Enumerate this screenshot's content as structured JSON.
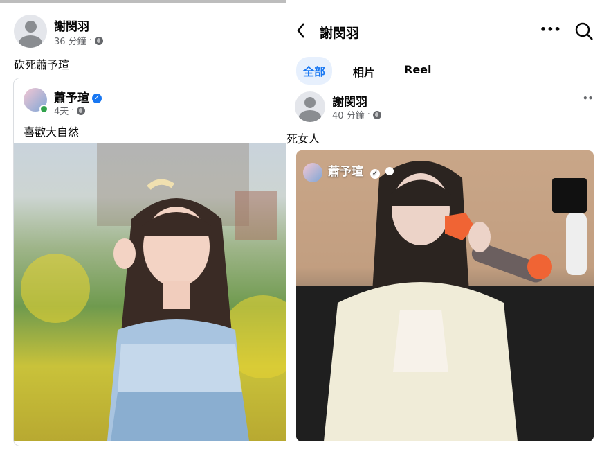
{
  "left": {
    "author": {
      "name": "謝閔羽",
      "time": "36 分鐘",
      "dot": "·"
    },
    "post_text": "砍死蕭予瑄",
    "shared_post": {
      "author": "蕭予瑄",
      "time": "4天",
      "dot": "·",
      "text": "喜歡大自然"
    }
  },
  "right": {
    "header": {
      "back": "<",
      "title": "謝閔羽",
      "more": "•••"
    },
    "tabs": [
      {
        "label": "全部",
        "active": true
      },
      {
        "label": "相片",
        "active": false
      },
      {
        "label": "Reel",
        "active": false
      }
    ],
    "post": {
      "author": "謝閔羽",
      "time": "40 分鐘",
      "dot": "·",
      "more": "••",
      "text": "死女人",
      "video_author": "蕭予瑄"
    }
  },
  "colors": {
    "accent": "#1877f2",
    "secondary_text": "#65676b",
    "online": "#31a24c"
  }
}
